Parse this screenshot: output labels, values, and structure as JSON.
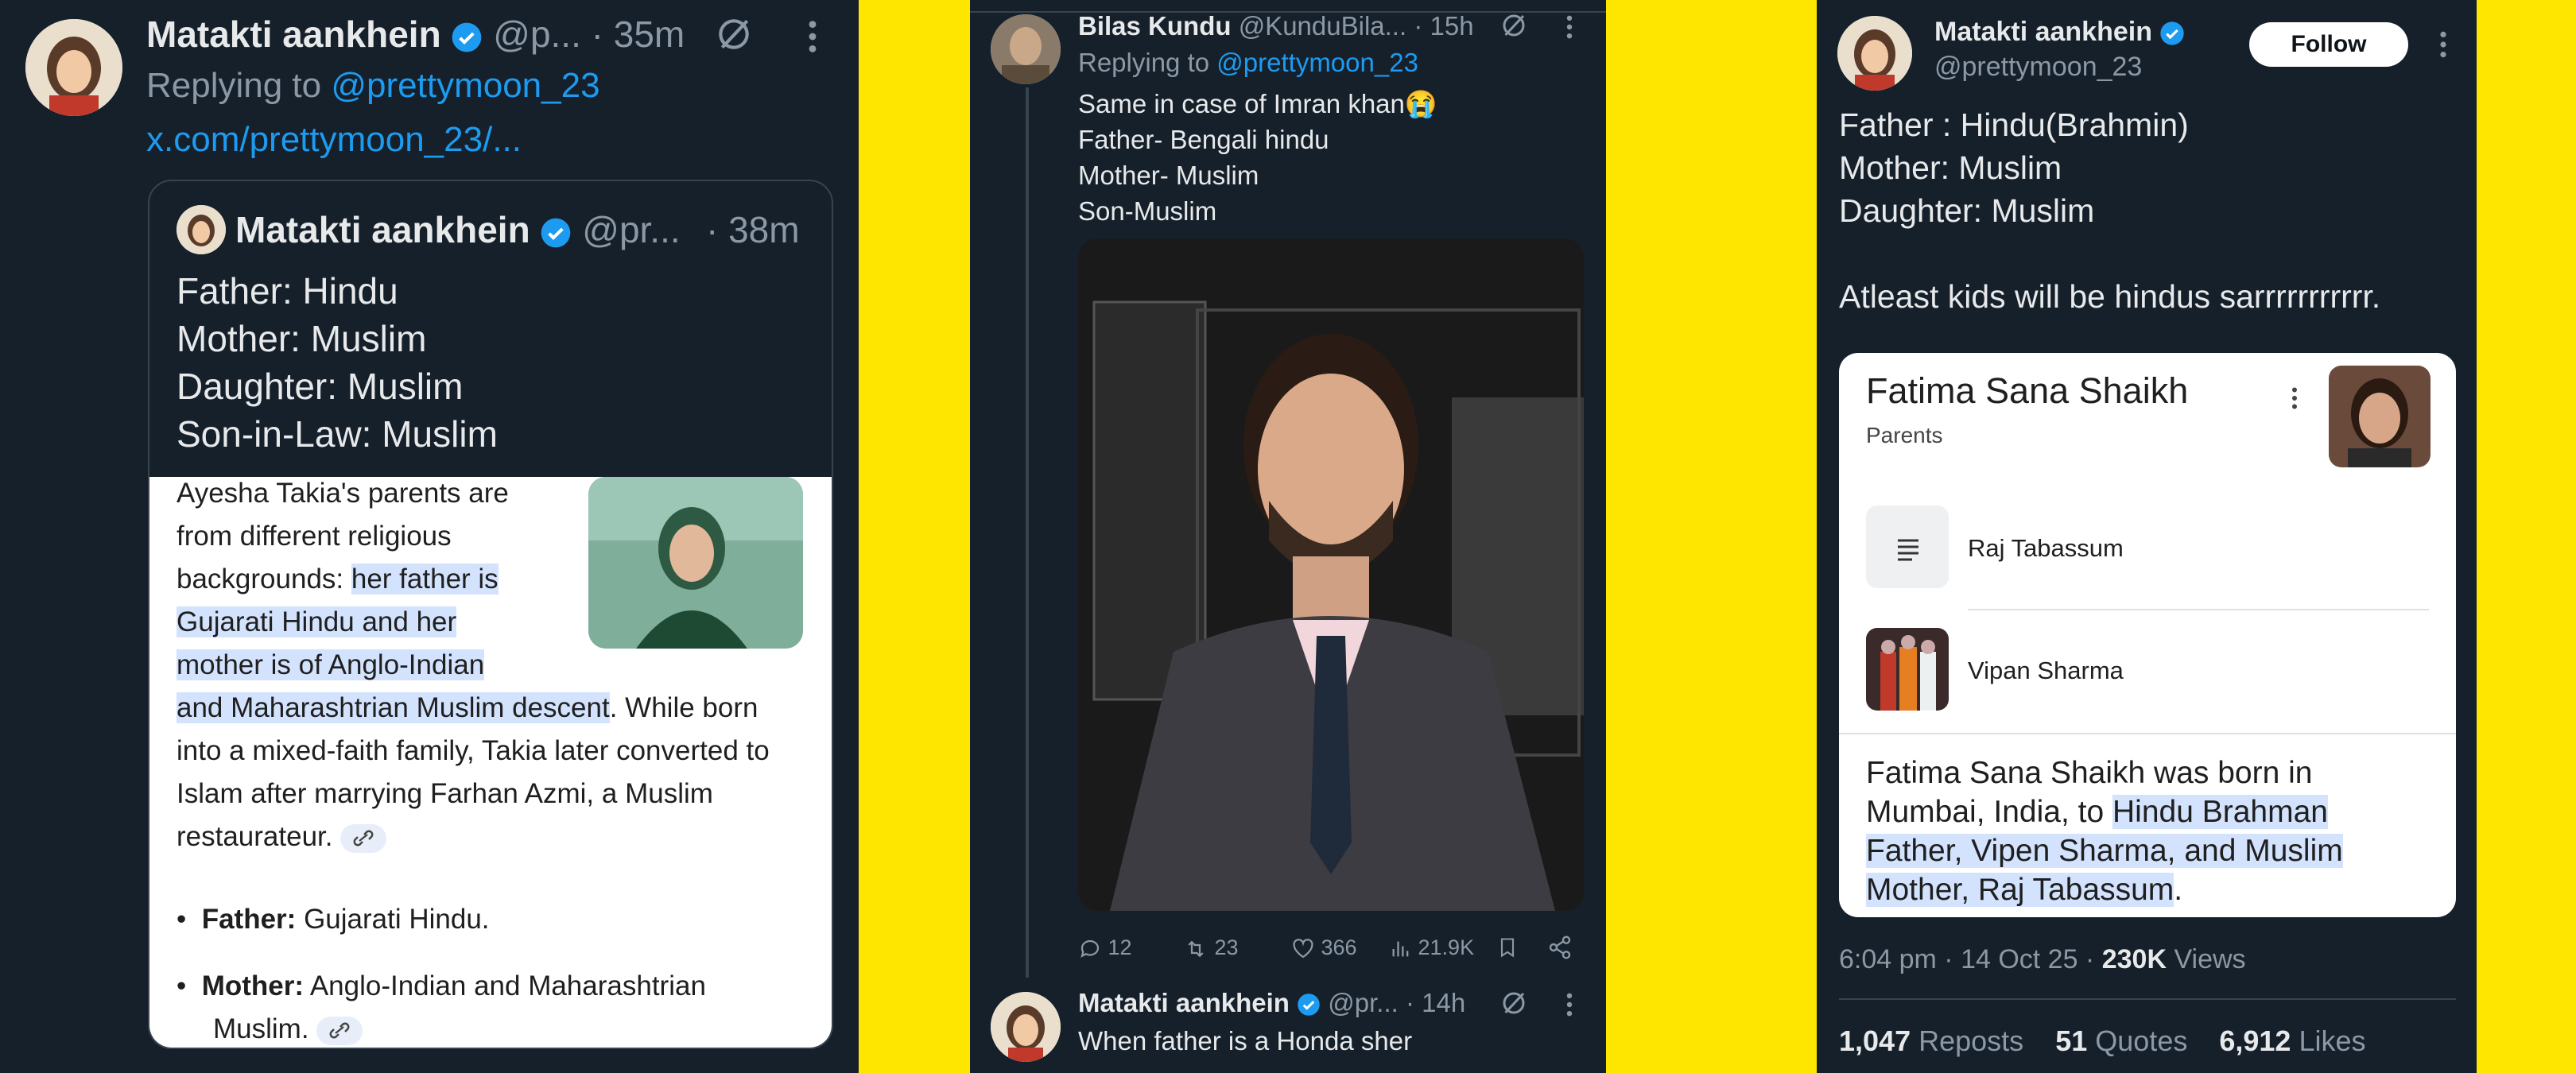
{
  "panel1": {
    "author": "Matakti aankhein",
    "handle": "@p...",
    "time": "· 35m",
    "replying_prefix": "Replying to",
    "replying_handle": "@prettymoon_23",
    "link": "x.com/prettymoon_23/...",
    "quote": {
      "author": "Matakti aankhein",
      "handle": "@pr...",
      "time": "· 38m",
      "lines": [
        "Father: Hindu",
        "Mother: Muslim",
        "Daughter: Muslim",
        "Son-in-Law: Muslim"
      ]
    },
    "card": {
      "p1": "Ayesha Takia's parents are",
      "p2": "from different religious",
      "p3": "backgrounds:",
      "h1": "her father is",
      "h2": "Gujarati Hindu and her",
      "h3": "mother is of Anglo-Indian",
      "h4": "and Maharashtrian Muslim descent",
      "p4": ". While born",
      "p5": "into a mixed-faith family, Takia later converted to",
      "p6": "Islam after marrying Farhan Azmi, a Muslim",
      "p7": "restaurateur.",
      "bullets": [
        {
          "label": "Father:",
          "text": "Gujarati Hindu."
        },
        {
          "label": "Mother:",
          "text": "Anglo-Indian and Maharashtrian",
          "text2": "Muslim."
        }
      ]
    }
  },
  "panel2": {
    "author": "Bilas Kundu",
    "handle": "@KunduBila...",
    "time": "· 15h",
    "replying_prefix": "Replying to",
    "replying_handle": "@prettymoon_23",
    "lines": [
      "Same in case of Imran khan😭",
      "Father- Bengali hindu",
      "Mother- Muslim",
      "Son-Muslim"
    ],
    "actions": {
      "replies": "12",
      "reposts": "23",
      "likes": "366",
      "views": "21.9K"
    },
    "next": {
      "author": "Matakti aankhein",
      "handle": "@pr...",
      "time": "· 14h",
      "text": "When father is a Honda sher"
    }
  },
  "panel3": {
    "author": "Matakti aankhein",
    "handle": "@prettymoon_23",
    "follow": "Follow",
    "lines": [
      "Father : Hindu(Brahmin)",
      "Mother: Muslim",
      "Daughter: Muslim",
      "",
      "Atleast kids will be hindus sarrrrrrrrrrr."
    ],
    "card": {
      "title": "Fatima Sana Shaikh",
      "subtitle": "Parents",
      "parent1": "Raj Tabassum",
      "parent2": "Vipan Sharma",
      "d1": "Fatima Sana Shaikh was born in",
      "d2": "Mumbai, India, to",
      "h1": "Hindu Brahman",
      "h2": "Father, Vipen Sharma, and Muslim",
      "h3": "Mother, Raj Tabassum",
      "d3": "."
    },
    "meta": {
      "time": "6:04 pm · 14 Oct 25 ·",
      "views": "230K",
      "views_label": "Views"
    },
    "stats": {
      "reposts": "1,047",
      "reposts_label": "Reposts",
      "quotes": "51",
      "quotes_label": "Quotes",
      "likes": "6,912",
      "likes_label": "Likes"
    }
  },
  "colors": {
    "background": "#ffe600",
    "panel": "#15202b",
    "accent": "#1d9bf0",
    "highlight": "#d3e3fd"
  }
}
